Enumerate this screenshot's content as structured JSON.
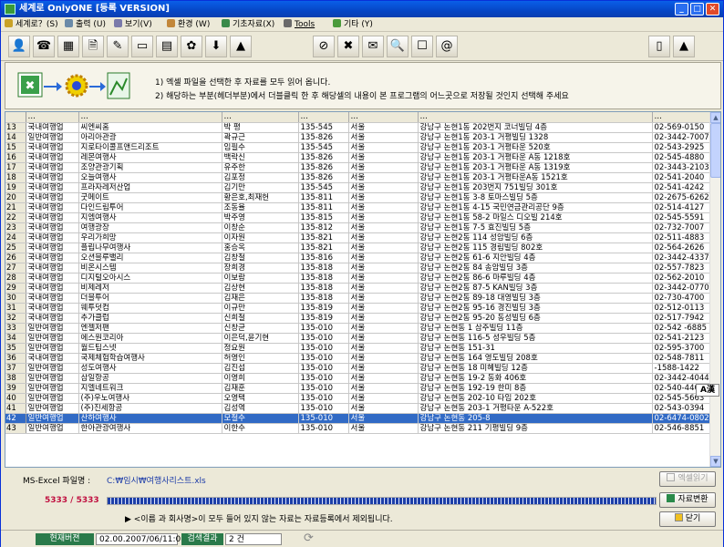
{
  "window": {
    "title": "세계로 OnlyONE [등록 VERSION]",
    "minimize": "_",
    "maximize": "□",
    "close": "✕"
  },
  "menu": [
    {
      "label": "세계로？(S)",
      "color": "#c9a227"
    },
    {
      "label": "출력 (U)",
      "color": "#6a8aa8"
    },
    {
      "label": "보기(V)",
      "color": "#7a7aaa"
    },
    {
      "label": "환경 (W)",
      "color": "#c2873a"
    },
    {
      "label": "기초자료(X)",
      "color": "#3a8a4a"
    },
    {
      "label": "Tools",
      "color": "#6a6a6a"
    },
    {
      "label": "기타 (Y)",
      "color": "#4a9a3a"
    }
  ],
  "toolbar": {
    "left": [
      {
        "name": "user-icon",
        "glyph": "👤"
      },
      {
        "name": "phone-icon",
        "glyph": "☎"
      },
      {
        "name": "building-icon",
        "glyph": "▦"
      },
      {
        "name": "document-icon",
        "glyph": "🗎"
      },
      {
        "name": "edit-icon",
        "glyph": "✎"
      },
      {
        "name": "monitor-icon",
        "glyph": "▭"
      },
      {
        "name": "calendar-icon",
        "glyph": "▤"
      },
      {
        "name": "tools-icon",
        "glyph": "✿"
      },
      {
        "name": "arrow-icon",
        "glyph": "⬇"
      },
      {
        "name": "chart-icon",
        "glyph": "▲"
      }
    ],
    "middle": [
      {
        "name": "no-smoking-icon",
        "glyph": "⊘"
      },
      {
        "name": "excel-icon",
        "glyph": "✖"
      },
      {
        "name": "email-icon",
        "glyph": "✉"
      },
      {
        "name": "search-icon",
        "glyph": "🔍"
      },
      {
        "name": "blank-page-icon",
        "glyph": "☐"
      },
      {
        "name": "at-icon",
        "glyph": "@"
      }
    ],
    "right": [
      {
        "name": "exit-door-icon",
        "glyph": "▯"
      },
      {
        "name": "logo-icon",
        "glyph": "▲"
      }
    ]
  },
  "guide": {
    "line1": "1) 엑셀 파일을 선택한 후 자료를 모두 읽어 옵니다.",
    "line2": "2) 해당하는 부분(헤더부분)에서 더블클릭 한 후  해당셀의 내용이 본 프로그램의 어느곳으로 저장될 것인지 선택해 주세요"
  },
  "table": {
    "headers": [
      "",
      "…",
      "…",
      "…",
      "…",
      "…",
      "…",
      "…"
    ],
    "rows": [
      [
        "13",
        "국내여행업",
        "씨엔씨홈",
        "박 평",
        "135-545",
        "서울",
        "강남구 논현1동 202번지 코너빌딩 4층",
        "02-569-0150"
      ],
      [
        "14",
        "일반여행업",
        "아리아관광",
        "곽규근",
        "135-826",
        "서울",
        "강남구 논현1동 203-1 거평빌딩 1328",
        "02-3442-7007"
      ],
      [
        "15",
        "국내여행업",
        "지로타이콜프앤드리조트",
        "임필수",
        "135-545",
        "서울",
        "강남구 논현1동 203-1 거평타운 520호",
        "02-543-2925"
      ],
      [
        "16",
        "국내여행업",
        "레몬여행사",
        "백락신",
        "135-826",
        "서울",
        "강남구 논현1동 203-1 거평타운 A동 1218호",
        "02-545-4880"
      ],
      [
        "17",
        "국내여행업",
        "조양관광기획",
        "유주한",
        "135-826",
        "서울",
        "강남구 논현1동 203-1 거평타운 A동 1319호",
        "02-3443-2103"
      ],
      [
        "18",
        "국내여행업",
        "오늘여행사",
        "김포정",
        "135-826",
        "서울",
        "강남구 논현1동 203-1 거평타운A동 1521호",
        "02-541-2040"
      ],
      [
        "19",
        "국내여행업",
        "프라자레저산업",
        "김기만",
        "135-545",
        "서울",
        "강남구 논현1동 203번지 751빌딩 301호",
        "02-541-4242"
      ],
      [
        "20",
        "국내여행업",
        "굿메이트",
        "황은호,최재헌",
        "135-811",
        "서울",
        "강남구 논현1동 3-8 토마스빌딩 5층",
        "02-2675-6262"
      ],
      [
        "21",
        "국내여행업",
        "다인드림투어",
        "조동율",
        "135-811",
        "서울",
        "강남구 논현1동 4-15 국민연금관리공단 9층",
        "02-514-4127"
      ],
      [
        "22",
        "국내여행업",
        "지엠여행사",
        "박주영",
        "135-815",
        "서울",
        "강남구 논현1동 58-2 마일스 디오빌 214호",
        "02-545-5591"
      ],
      [
        "23",
        "국내여행업",
        "여행광장",
        "이창순",
        "135-812",
        "서울",
        "강남구 논현1동 7-5 효진빌딩 5층",
        "02-732-7007"
      ],
      [
        "24",
        "국내여행업",
        "우리가희망",
        "이자원",
        "135-821",
        "서울",
        "강남구 논현2동 114 성암빌딩 6층",
        "02-511-4883"
      ],
      [
        "25",
        "국내여행업",
        "플립나무여행사",
        "홍승옥",
        "135-821",
        "서울",
        "강남구 논현2동 115 경림빌딩 802호",
        "02-564-2626"
      ],
      [
        "26",
        "국내여행업",
        "오션블루밸리",
        "김창철",
        "135-816",
        "서울",
        "강남구 논현2동 61-6 지안빌딩 4층",
        "02-3442-4337"
      ],
      [
        "27",
        "국내여행업",
        "비온시스템",
        "장희경",
        "135-818",
        "서울",
        "강남구 논현2동 84 송암빌딩 3층",
        "02-557-7823"
      ],
      [
        "28",
        "국내여행업",
        "디지털오아시스",
        "이보람",
        "135-818",
        "서울",
        "강남구 논현2동 86-6 마루빌딩 4층",
        "02-562-2010"
      ],
      [
        "29",
        "국내여행업",
        "비제레저",
        "김상현",
        "135-818",
        "서울",
        "강남구 논현2동 87-5 KAN빌딩 3층",
        "02-3442-0770"
      ],
      [
        "30",
        "국내여행업",
        "더블투어",
        "김재은",
        "135-818",
        "서울",
        "강남구 논현2동 89-18 대영빌딩 3층",
        "02-730-4700"
      ],
      [
        "31",
        "국내여행업",
        "웨투덧컴",
        "이규만",
        "135-819",
        "서울",
        "강남구 논현2동 95-16 경진빌딩 3층",
        "02-512-0113"
      ],
      [
        "32",
        "국내여행업",
        "추가클럽",
        "신희철",
        "135-819",
        "서울",
        "강남구 논현2동 95-20 동성빌딩 6층",
        "02-517-7942"
      ],
      [
        "33",
        "일반여행업",
        "엔젤저팬",
        "신창균",
        "135-010",
        "서울",
        "강남구 논현동 1 삼주빌딩 11층",
        "02-542 -6885"
      ],
      [
        "34",
        "일반여행업",
        "에스원코리아",
        "이은덕,윤기현",
        "135-010",
        "서울",
        "강남구 논현동 116-5 성우빌딩 5층",
        "02-541-2123"
      ],
      [
        "35",
        "일반여행업",
        "월드팁스넷",
        "정요원",
        "135-010",
        "서울",
        "강남구 논현동 151-31",
        "02-595-3700"
      ],
      [
        "36",
        "국내여행업",
        "국제체험학습여행사",
        "허영인",
        "135-010",
        "서울",
        "강남구 논현동 164 영도빌딩 208호",
        "02-548-7811"
      ],
      [
        "37",
        "일반여행업",
        "성도여행사",
        "김진섭",
        "135-010",
        "서울",
        "강남구 논현동 18 미혜빌딩 12층",
        "-1588-1422"
      ],
      [
        "38",
        "일반여행업",
        "삼일항공",
        "이영희",
        "135-010",
        "서울",
        "강남구 논현동 19-2 동화 406호",
        "02-3442-4044"
      ],
      [
        "39",
        "일반여행업",
        "지엘네트워크",
        "김재훈",
        "135-010",
        "서울",
        "강남구 논현동 192-19 한미 8층",
        "02-540-4400"
      ],
      [
        "40",
        "일반여행업",
        "(주)우노여행사",
        "오영택",
        "135-010",
        "서울",
        "강남구 논현동 202-10 타임 202호",
        "02-545-5663"
      ],
      [
        "41",
        "일반여행업",
        "(주)진세항공",
        "김성역",
        "135-010",
        "서울",
        "강남구 논현동 203-1 거평타운 A-522호",
        "02-543-0394"
      ],
      [
        "42",
        "일반여행업",
        "산하여행사",
        "모철수",
        "135-010",
        "서울",
        "강남구 논현동 205-8",
        "02-6474-0802"
      ],
      [
        "43",
        "일반여행업",
        "한아관광여행사",
        "이한수",
        "135-010",
        "서울",
        "강남구 논현동 211 기평빌딩 9층",
        "02-546-8851"
      ]
    ],
    "selected_row": "42"
  },
  "ime": "A漢",
  "bottom": {
    "file_label": "MS-Excel 파일명 :",
    "file_path": "C:₩임시₩여행사리스트.xls",
    "counter": "5333 / 5333",
    "progress_percent": 100,
    "notice": "<이름 과 회사명>이 모두 들어 있지 않는 자료는 자료등록에서 제외됩니다.",
    "notice_arrow": "▶",
    "read_button": "엑셀읽기",
    "convert_button": "자료변환",
    "close_button": "닫기"
  },
  "status": {
    "version_label": "현재버젼",
    "version_value": "02.00.2007/06/11:0",
    "result_label": "검색결과",
    "result_value": "2 건"
  },
  "colors": {
    "titlebar": "#0a50d8",
    "selected_row": "#316ac5",
    "counter": "#c01040",
    "file_path": "#1a3aa8"
  }
}
